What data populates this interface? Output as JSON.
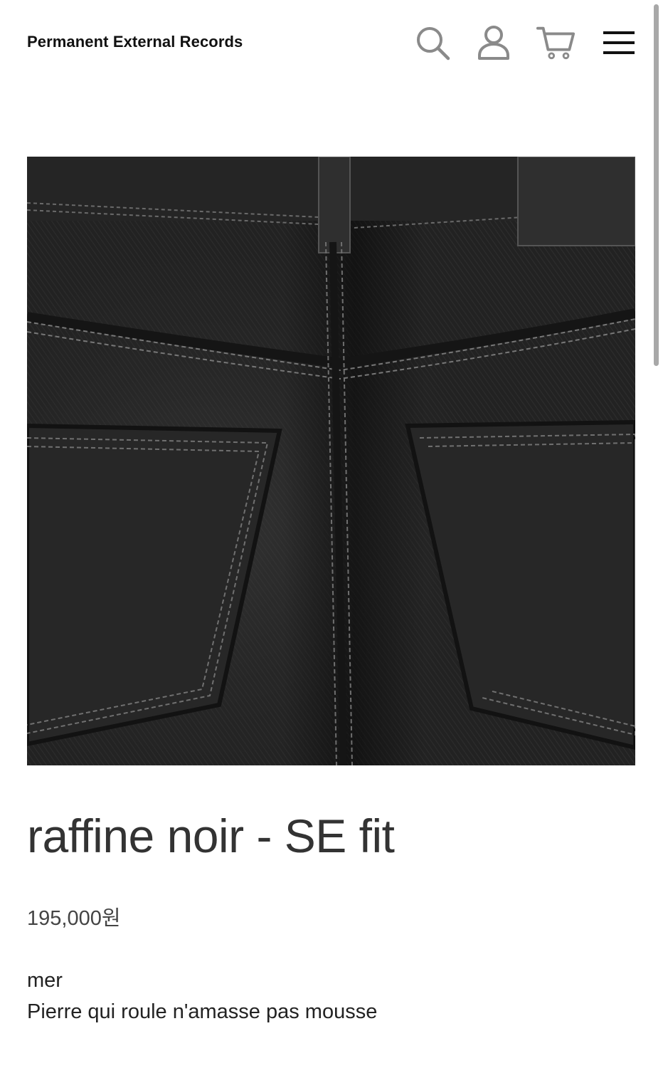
{
  "header": {
    "brand": "Permanent External Records",
    "icons": [
      "search-icon",
      "user-icon",
      "cart-icon",
      "menu-icon"
    ]
  },
  "product": {
    "image_description_icon": "product-photo",
    "title": "raffine noir - SE fit",
    "price": "195,000원",
    "description": {
      "line1": "mer",
      "line2": "Pierre qui roule n'amasse pas mousse"
    }
  },
  "colors": {
    "background": "#ffffff",
    "text": "#222222",
    "title": "#333333",
    "icon": "#8a8a8a",
    "denim": "#2a2a2a"
  }
}
